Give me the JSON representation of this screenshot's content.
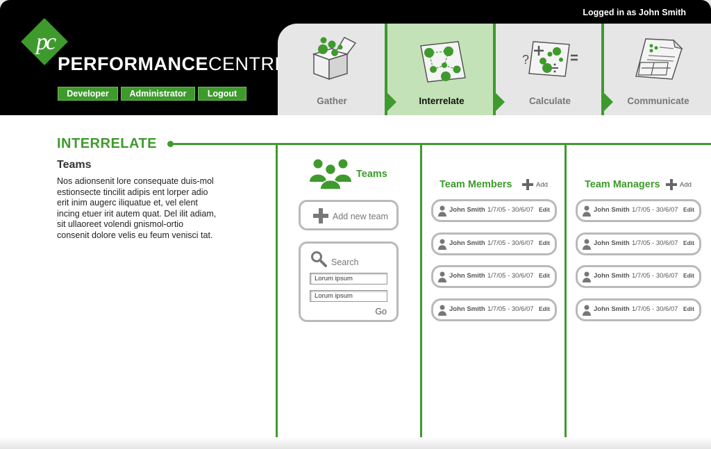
{
  "header": {
    "login_status": "Logged in as John Smith",
    "logo": {
      "mark": "pc",
      "brand_bold": "PERFORMANCE",
      "brand_light": "CENTRE"
    },
    "buttons": {
      "developer": "Developer",
      "administrator": "Administrator",
      "logout": "Logout"
    }
  },
  "tabs": [
    {
      "label": "Gather",
      "icon": "open-box-icon",
      "active": false
    },
    {
      "label": "Interrelate",
      "icon": "connected-nodes-map-icon",
      "active": true
    },
    {
      "label": "Calculate",
      "icon": "math-operations-icon",
      "active": false
    },
    {
      "label": "Communicate",
      "icon": "report-document-icon",
      "active": false
    }
  ],
  "main": {
    "section_title": "INTERRELATE",
    "intro": {
      "heading": "Teams",
      "text": "Nos adionsenit lore consequate duis-mol estionsecte tincilit adipis ent lorper adio erit inim augerc iliquatue et, vel elent incing etuer irit autem quat. Del ilit adiam, sit ullaoreet volendi gnismol-ortio consenit dolore velis eu feum venisci tat."
    },
    "teams": {
      "label": "Teams",
      "add_new": "Add new team",
      "search_label": "Search",
      "field1": "Lorum ipsum",
      "field2": "Lorum ipsum",
      "go": "Go"
    },
    "team_members": {
      "heading": "Team Members",
      "add": "Add",
      "rows": [
        {
          "name": "John Smith",
          "dates": "1/7/05 - 30/6/07",
          "edit": "Edit"
        },
        {
          "name": "John Smith",
          "dates": "1/7/05 - 30/6/07",
          "edit": "Edit"
        },
        {
          "name": "John Smith",
          "dates": "1/7/05 - 30/6/07",
          "edit": "Edit"
        },
        {
          "name": "John Smith",
          "dates": "1/7/05 - 30/6/07",
          "edit": "Edit"
        }
      ]
    },
    "team_managers": {
      "heading": "Team Managers",
      "add": "Add",
      "rows": [
        {
          "name": "John Smith",
          "dates": "1/7/05 - 30/6/07",
          "edit": "Edit"
        },
        {
          "name": "John Smith",
          "dates": "1/7/05 - 30/6/07",
          "edit": "Edit"
        },
        {
          "name": "John Smith",
          "dates": "1/7/05 - 30/6/07",
          "edit": "Edit"
        },
        {
          "name": "John Smith",
          "dates": "1/7/05 - 30/6/07",
          "edit": "Edit"
        }
      ]
    }
  },
  "colors": {
    "accent": "#3f9a2e",
    "active_tab": "#c4e2b8",
    "tab_bg": "#e6e6e6",
    "border": "#b9b9b9"
  }
}
